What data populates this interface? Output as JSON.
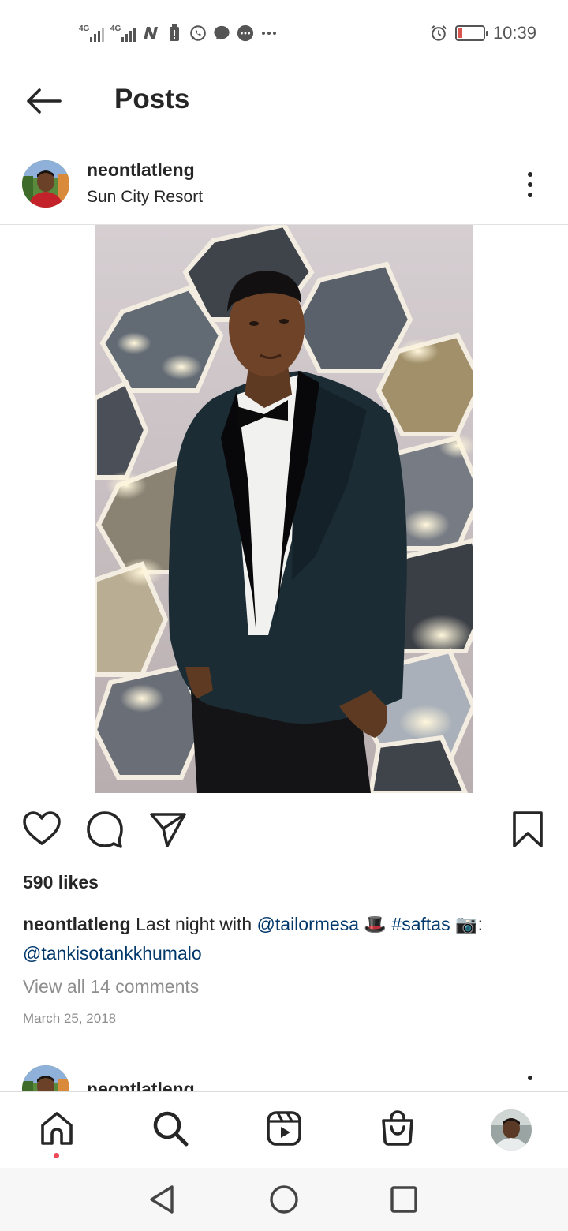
{
  "status_bar": {
    "network1": "4G",
    "network2": "4G",
    "time": "10:39",
    "battery_level": 0.15,
    "icons": [
      "signal-icon",
      "signal-icon",
      "n-app-icon",
      "battery-alert-icon",
      "whatsapp-icon",
      "chat-bubble-icon",
      "message-icon",
      "more-dots-icon",
      "alarm-icon",
      "battery-icon"
    ]
  },
  "header": {
    "title": "Posts",
    "back_icon": "arrow-left-icon"
  },
  "post": {
    "username": "neontlatleng",
    "location": "Sun City Resort",
    "likes": "590 likes",
    "caption_user": "neontlatleng",
    "caption_text1": "Last night with",
    "mention1": "@tailormesa",
    "emoji_hat": "🎩",
    "hashtag": "#saftas",
    "emoji_camera": "📷",
    "colon": ":",
    "mention2": "@tankisotankkhumalo",
    "view_comments": "View all 14 comments",
    "date": "March 25, 2018"
  },
  "next_post": {
    "username": "neontlatleng"
  },
  "bottom_nav": {
    "items": [
      "home-icon",
      "search-icon",
      "reels-icon",
      "shop-icon",
      "profile-avatar"
    ]
  },
  "system_nav": {
    "items": [
      "back-triangle-icon",
      "home-circle-icon",
      "recents-square-icon"
    ]
  },
  "colors": {
    "text": "#262626",
    "link": "#00376b",
    "muted": "#8e8e8e",
    "notification_dot": "#ed4956"
  }
}
